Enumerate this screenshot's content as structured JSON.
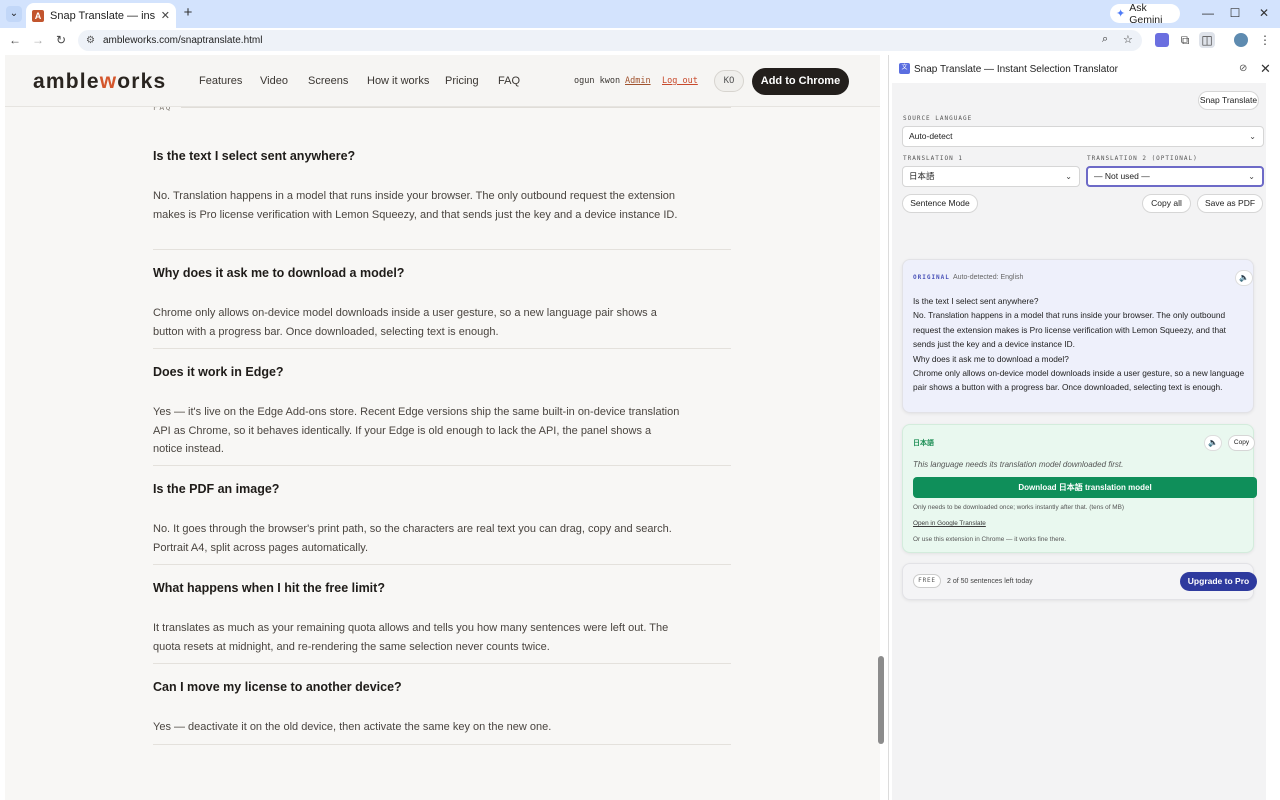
{
  "browser": {
    "tab_title": "Snap Translate — instant selecti",
    "tab_favicon": "A",
    "ask_gemini": "Ask Gemini",
    "url": "ambleworks.com/snaptranslate.html"
  },
  "site": {
    "logo_text": "ambleworks",
    "nav": [
      "Features",
      "Video",
      "Screens",
      "How it works",
      "Pricing",
      "FAQ"
    ],
    "user_name": "ogun kwon",
    "admin_link": "Admin",
    "logout_link": "Log out",
    "lang_badge": "KO",
    "cta": "Add to Chrome"
  },
  "faq": {
    "section_label": "FAQ",
    "items": [
      {
        "q": "Is the text I select sent anywhere?",
        "a": "No. Translation happens in a model that runs inside your browser. The only outbound request the extension makes is Pro license verification with Lemon Squeezy, and that sends just the key and a device instance ID."
      },
      {
        "q": "Why does it ask me to download a model?",
        "a": "Chrome only allows on-device model downloads inside a user gesture, so a new language pair shows a button with a progress bar. Once downloaded, selecting text is enough."
      },
      {
        "q": "Does it work in Edge?",
        "a": "Yes — it's live on the Edge Add-ons store. Recent Edge versions ship the same built-in on-device translation API as Chrome, so it behaves identically. If your Edge is old enough to lack the API, the panel shows a notice instead."
      },
      {
        "q": "Is the PDF an image?",
        "a": "No. It goes through the browser's print path, so the characters are real text you can drag, copy and search. Portrait A4, split across pages automatically."
      },
      {
        "q": "What happens when I hit the free limit?",
        "a": "It translates as much as your remaining quota allows and tells you how many sentences were left out. The quota resets at midnight, and re-rendering the same selection never counts twice."
      },
      {
        "q": "Can I move my license to another device?",
        "a": "Yes — deactivate it on the old device, then activate the same key on the new one."
      }
    ]
  },
  "panel": {
    "title": "Snap Translate — Instant Selection Translator",
    "snap_button": "Snap Translate",
    "source_label": "SOURCE LANGUAGE",
    "source_value": "Auto-detect",
    "t1_label": "TRANSLATION 1",
    "t1_value": "日本語",
    "t2_label": "TRANSLATION 2 (OPTIONAL)",
    "t2_value": "— Not used —",
    "sentence_mode": "Sentence Mode",
    "copy_all": "Copy all",
    "save_pdf": "Save as PDF",
    "original": {
      "tag": "ORIGINAL",
      "detected": "Auto-detected: English",
      "text": "Is the text I select sent anywhere?\nNo. Translation happens in a model that runs inside your browser. The only outbound request the extension makes is Pro license verification with Lemon Squeezy, and that sends just the key and a device instance ID.\nWhy does it ask me to download a model?\nChrome only allows on-device model downloads inside a user gesture, so a new language pair shows a button with a progress bar. Once downloaded, selecting text is enough."
    },
    "translation": {
      "tag": "日本語",
      "copy": "Copy",
      "note": "This language needs its translation model downloaded first.",
      "download": "Download 日本語 translation model",
      "once": "Only needs to be downloaded once; works instantly after that. (tens of MB)",
      "google": "Open in Google Translate",
      "chrome_hint": "Or use this extension in Chrome — it works fine there."
    },
    "quota": {
      "badge": "FREE",
      "text": "2 of 50 sentences left today",
      "upgrade": "Upgrade to Pro"
    }
  },
  "colors": {
    "accent": "#d4562c",
    "cta_bg": "#231f1c",
    "download_green": "#0f8f5a",
    "upgrade_blue": "#2e3a9e"
  }
}
